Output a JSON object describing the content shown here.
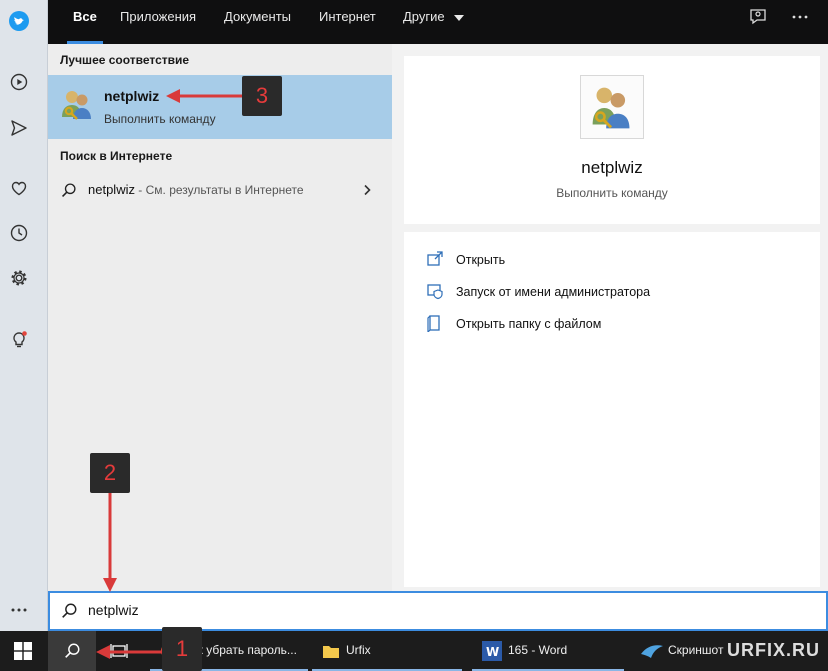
{
  "tabs": [
    {
      "label": "Все",
      "active": true
    },
    {
      "label": "Приложения"
    },
    {
      "label": "Документы"
    },
    {
      "label": "Интернет"
    },
    {
      "label": "Другие"
    }
  ],
  "left": {
    "best_title": "Лучшее соответствие",
    "best": {
      "name": "netplwiz",
      "sub": "Выполнить команду"
    },
    "web_title": "Поиск в Интернете",
    "web": {
      "query": "netplwiz",
      "hint": " - См. результаты в Интернете"
    }
  },
  "preview": {
    "title": "netplwiz",
    "sub": "Выполнить команду",
    "actions": [
      "Открыть",
      "Запуск от имени администратора",
      "Открыть папку с файлом"
    ]
  },
  "search": {
    "value": "netplwiz"
  },
  "taskbar": [
    {
      "label": "Как убрать пароль..."
    },
    {
      "label": "Urfix"
    },
    {
      "label": "165 - Word"
    },
    {
      "label": "Скриншот"
    }
  ],
  "callouts": [
    "1",
    "2",
    "3"
  ],
  "watermark": "URFIX.RU",
  "colors": {
    "accent": "#3c8ce0",
    "highlight": "#a7cce8",
    "arrow": "#d93a3a",
    "taskbar": "#1c1c1c"
  },
  "icons": {
    "sidebar": [
      "twitter-icon",
      "play-icon",
      "send-icon",
      "heart-icon",
      "clock-icon",
      "gear-icon",
      "lightbulb-icon",
      "more-icon"
    ],
    "topbar": [
      "feedback-icon",
      "more-icon"
    ],
    "actions": [
      "open-icon",
      "run-as-admin-icon",
      "open-folder-icon"
    ]
  }
}
